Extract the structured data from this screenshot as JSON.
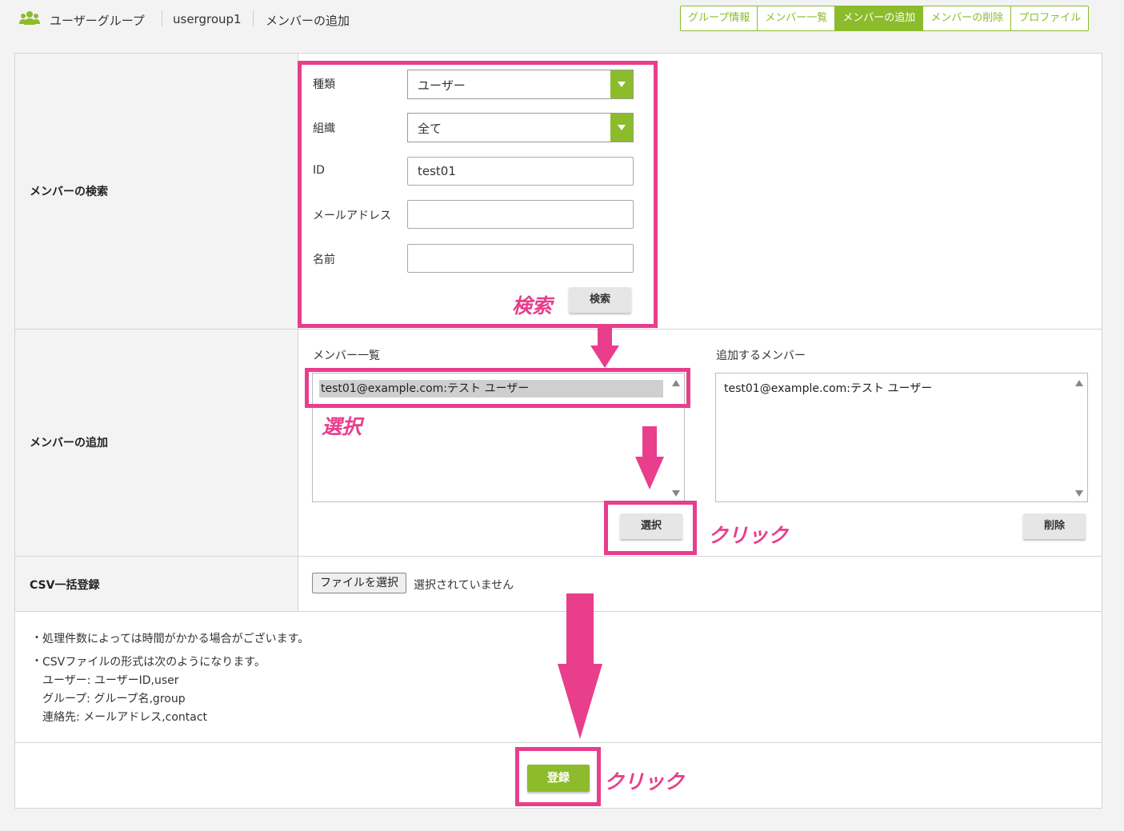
{
  "header": {
    "icon": "users-icon",
    "crumbs": [
      "ユーザーグループ",
      "usergroup1",
      "メンバーの追加"
    ],
    "tabs": [
      {
        "label": "グループ情報",
        "active": false
      },
      {
        "label": "メンバー一覧",
        "active": false
      },
      {
        "label": "メンバーの追加",
        "active": true
      },
      {
        "label": "メンバーの削除",
        "active": false
      },
      {
        "label": "プロファイル",
        "active": false
      }
    ]
  },
  "search": {
    "section_label": "メンバーの検索",
    "type_label": "種類",
    "type_value": "ユーザー",
    "org_label": "組織",
    "org_value": "全て",
    "id_label": "ID",
    "id_value": "test01",
    "email_label": "メールアドレス",
    "email_value": "",
    "name_label": "名前",
    "name_value": "",
    "button_label": "検索"
  },
  "add": {
    "section_label": "メンバーの追加",
    "list_title": "メンバー一覧",
    "list_items": [
      "test01@example.com:テスト ユーザー"
    ],
    "selected_title": "追加するメンバー",
    "selected_items": [
      "test01@example.com:テスト ユーザー"
    ],
    "select_button": "選択",
    "remove_button": "削除"
  },
  "csv": {
    "section_label": "CSV一括登録",
    "file_button": "ファイルを選択",
    "file_status": "選択されていません"
  },
  "notes": {
    "line1": "処理件数によっては時間がかかる場合がございます。",
    "line2": "CSVファイルの形式は次のようになります。",
    "line3": "ユーザー: ユーザーID,user",
    "line4": "グループ: グループ名,group",
    "line5": "連絡先: メールアドレス,contact"
  },
  "submit_label": "登録",
  "annotations": {
    "search": "検索",
    "select": "選択",
    "click1": "クリック",
    "click2": "クリック",
    "color": "#e83e8c"
  },
  "colors": {
    "accent": "#8cbc2c",
    "annotation": "#e83e8c"
  }
}
